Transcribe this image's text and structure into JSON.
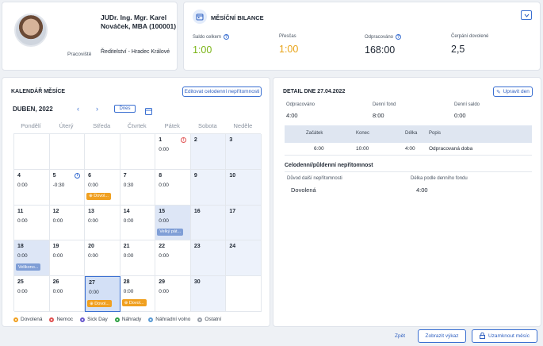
{
  "profile": {
    "name": "JUDr. Ing. Mgr. Karel Nováček, MBA (100001)",
    "workplace_label": "Pracoviště",
    "workplace_value": "Ředitelství - Hradec Králové"
  },
  "balance": {
    "title": "MĚSÍČNÍ BILANCE",
    "stats": [
      {
        "label": "Saldo celkem",
        "value": "1:00",
        "color": "#7cb518",
        "info": true
      },
      {
        "label": "Přesčas",
        "value": "1:00",
        "color": "#e8a317",
        "info": false
      },
      {
        "label": "Odpracováno",
        "value": "168:00",
        "color": "#1f2733",
        "info": true
      },
      {
        "label": "Čerpání dovolené",
        "value": "2,5",
        "color": "#1f2733",
        "info": false
      }
    ]
  },
  "calendar": {
    "title": "KALENDÁŘ MĚSÍCE",
    "edit_button": "Editovat celodenní nepřítomnosti",
    "month": "DUBEN, 2022",
    "today_button": "Dnes",
    "weekdays": [
      "Pondělí",
      "Úterý",
      "Středa",
      "Čtvrtek",
      "Pátek",
      "Sobota",
      "Neděle"
    ],
    "days": [
      {
        "row": 0,
        "col": 4,
        "day": "1",
        "time": "0:00",
        "icon": "red"
      },
      {
        "row": 0,
        "col": 5,
        "day": "2",
        "time": "",
        "type": "we"
      },
      {
        "row": 0,
        "col": 6,
        "day": "3",
        "time": "",
        "type": "we"
      },
      {
        "row": 1,
        "col": 0,
        "day": "4",
        "time": "0:00"
      },
      {
        "row": 1,
        "col": 1,
        "day": "5",
        "time": "-0:30",
        "icon": "blue"
      },
      {
        "row": 1,
        "col": 2,
        "day": "6",
        "time": "0:00",
        "tag": "Dovol...",
        "tagColor": "orange"
      },
      {
        "row": 1,
        "col": 3,
        "day": "7",
        "time": "0:30"
      },
      {
        "row": 1,
        "col": 4,
        "day": "8",
        "time": "0:00"
      },
      {
        "row": 1,
        "col": 5,
        "day": "9",
        "time": "",
        "type": "we"
      },
      {
        "row": 1,
        "col": 6,
        "day": "10",
        "time": "",
        "type": "we"
      },
      {
        "row": 2,
        "col": 0,
        "day": "11",
        "time": "0:00"
      },
      {
        "row": 2,
        "col": 1,
        "day": "12",
        "time": "0:00"
      },
      {
        "row": 2,
        "col": 2,
        "day": "13",
        "time": "0:00"
      },
      {
        "row": 2,
        "col": 3,
        "day": "14",
        "time": "0:00"
      },
      {
        "row": 2,
        "col": 4,
        "day": "15",
        "time": "0:00",
        "type": "hol",
        "tag": "Velký pát...",
        "tagColor": "blue"
      },
      {
        "row": 2,
        "col": 5,
        "day": "16",
        "time": "",
        "type": "we"
      },
      {
        "row": 2,
        "col": 6,
        "day": "17",
        "time": "",
        "type": "we"
      },
      {
        "row": 3,
        "col": 0,
        "day": "18",
        "time": "0:00",
        "type": "hol",
        "tag": "Velikono...",
        "tagColor": "blue"
      },
      {
        "row": 3,
        "col": 1,
        "day": "19",
        "time": "0:00"
      },
      {
        "row": 3,
        "col": 2,
        "day": "20",
        "time": "0:00"
      },
      {
        "row": 3,
        "col": 3,
        "day": "21",
        "time": "0:00"
      },
      {
        "row": 3,
        "col": 4,
        "day": "22",
        "time": "0:00"
      },
      {
        "row": 3,
        "col": 5,
        "day": "23",
        "time": "",
        "type": "we"
      },
      {
        "row": 3,
        "col": 6,
        "day": "24",
        "time": "",
        "type": "we"
      },
      {
        "row": 4,
        "col": 0,
        "day": "25",
        "time": "0:00"
      },
      {
        "row": 4,
        "col": 1,
        "day": "26",
        "time": "0:00"
      },
      {
        "row": 4,
        "col": 2,
        "day": "27",
        "time": "0:00",
        "type": "sel",
        "tag": "Dovol...",
        "tagColor": "orange"
      },
      {
        "row": 4,
        "col": 3,
        "day": "28",
        "time": "0:00",
        "tag": "Dovol...",
        "tagColor": "orange"
      },
      {
        "row": 4,
        "col": 4,
        "day": "29",
        "time": "0:00"
      },
      {
        "row": 4,
        "col": 5,
        "day": "30",
        "time": "",
        "type": "we"
      }
    ],
    "legend": [
      {
        "label": "Dovolená",
        "color": "#f0a020"
      },
      {
        "label": "Nemoc",
        "color": "#e05252"
      },
      {
        "label": "Sick Day",
        "color": "#6a5acd"
      },
      {
        "label": "Náhrady",
        "color": "#2ea043"
      },
      {
        "label": "Náhradní volno",
        "color": "#5b9bd5"
      },
      {
        "label": "Ostatní",
        "color": "#9aa1ab"
      }
    ]
  },
  "detail": {
    "title": "DETAIL DNE 27.04.2022",
    "edit_button": "Upravit den",
    "summary": [
      {
        "label": "Odpracováno",
        "value": "4:00"
      },
      {
        "label": "Denní fond",
        "value": "8:00"
      },
      {
        "label": "Denní saldo",
        "value": "0:00"
      }
    ],
    "table_headers": [
      "Začátek",
      "Konec",
      "Délka",
      "Popis"
    ],
    "table_rows": [
      [
        "6:00",
        "10:00",
        "4:00",
        "Odpracovaná doba"
      ]
    ],
    "absence_title": "Celodenní/půldenní nepřítomnost",
    "absence_headers": [
      "Důvod další nepřítomnosti",
      "Délka podle denního fondu"
    ],
    "absence_values": [
      "Dovolená",
      "4:00"
    ]
  },
  "footer": {
    "back": "Zpět",
    "show_report": "Zobrazit výkaz",
    "lock_month": "Uzamknout měsíc"
  }
}
